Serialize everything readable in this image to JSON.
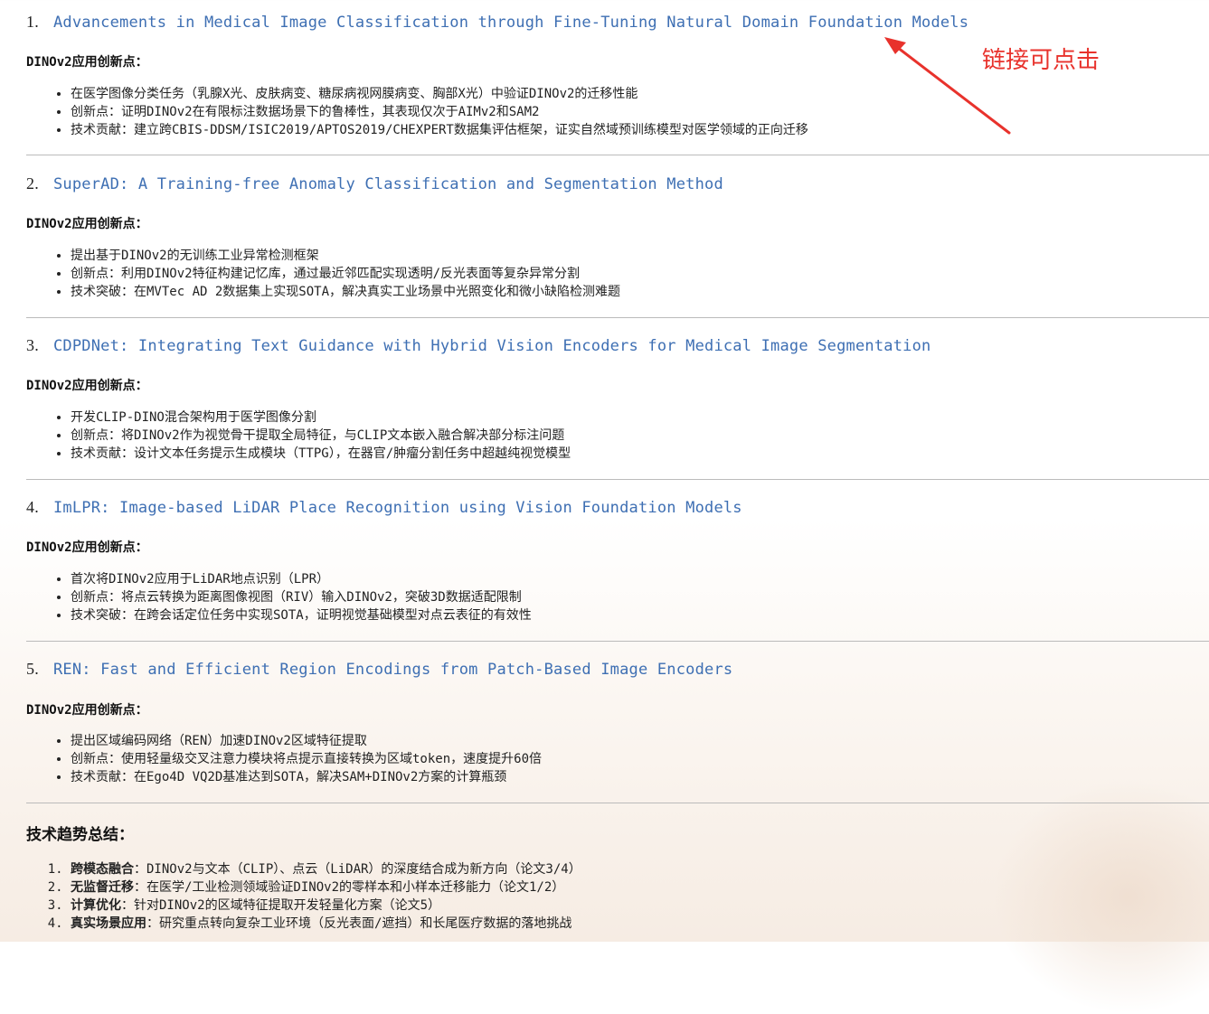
{
  "papers": [
    {
      "num": "1.",
      "title": "Advancements in Medical Image Classification through Fine-Tuning Natural Domain Foundation Models",
      "subheading": "DINOv2应用创新点：",
      "points": [
        "在医学图像分类任务（乳腺X光、皮肤病变、糖尿病视网膜病变、胸部X光）中验证DINOv2的迁移性能",
        "创新点：证明DINOv2在有限标注数据场景下的鲁棒性，其表现仅次于AIMv2和SAM2",
        "技术贡献：建立跨CBIS-DDSM/ISIC2019/APTOS2019/CHEXPERT数据集评估框架，证实自然域预训练模型对医学领域的正向迁移"
      ]
    },
    {
      "num": "2.",
      "title": "SuperAD: A Training-free Anomaly Classification and Segmentation Method",
      "subheading": "DINOv2应用创新点：",
      "points": [
        "提出基于DINOv2的无训练工业异常检测框架",
        "创新点：利用DINOv2特征构建记忆库，通过最近邻匹配实现透明/反光表面等复杂异常分割",
        "技术突破：在MVTec AD 2数据集上实现SOTA，解决真实工业场景中光照变化和微小缺陷检测难题"
      ]
    },
    {
      "num": "3.",
      "title": "CDPDNet: Integrating Text Guidance with Hybrid Vision Encoders for Medical Image Segmentation",
      "subheading": "DINOv2应用创新点：",
      "points": [
        "开发CLIP-DINO混合架构用于医学图像分割",
        "创新点：将DINOv2作为视觉骨干提取全局特征，与CLIP文本嵌入融合解决部分标注问题",
        "技术贡献：设计文本任务提示生成模块（TTPG），在器官/肿瘤分割任务中超越纯视觉模型"
      ]
    },
    {
      "num": "4.",
      "title": "ImLPR: Image-based LiDAR Place Recognition using Vision Foundation Models",
      "subheading": "DINOv2应用创新点：",
      "points": [
        "首次将DINOv2应用于LiDAR地点识别（LPR）",
        "创新点：将点云转换为距离图像视图（RIV）输入DINOv2，突破3D数据适配限制",
        "技术突破：在跨会话定位任务中实现SOTA，证明视觉基础模型对点云表征的有效性"
      ]
    },
    {
      "num": "5.",
      "title": "REN: Fast and Efficient Region Encodings from Patch-Based Image Encoders",
      "subheading": "DINOv2应用创新点：",
      "points": [
        "提出区域编码网络（REN）加速DINOv2区域特征提取",
        "创新点：使用轻量级交叉注意力模块将点提示直接转换为区域token，速度提升60倍",
        "技术贡献：在Ego4D VQ2D基准达到SOTA，解决SAM+DINOv2方案的计算瓶颈"
      ]
    }
  ],
  "summary": {
    "title": "技术趋势总结：",
    "items": [
      {
        "label": "跨模态融合",
        "text": "：DINOv2与文本（CLIP）、点云（LiDAR）的深度结合成为新方向（论文3/4）"
      },
      {
        "label": "无监督迁移",
        "text": "：在医学/工业检测领域验证DINOv2的零样本和小样本迁移能力（论文1/2）"
      },
      {
        "label": "计算优化",
        "text": "：针对DINOv2的区域特征提取开发轻量化方案（论文5）"
      },
      {
        "label": "真实场景应用",
        "text": "：研究重点转向复杂工业环境（反光表面/遮挡）和长尾医疗数据的落地挑战"
      }
    ]
  },
  "annotation": {
    "text": "链接可点击",
    "color": "#e8322c"
  },
  "colors": {
    "link": "#3e6fb3",
    "rule": "#bbbbbb"
  }
}
